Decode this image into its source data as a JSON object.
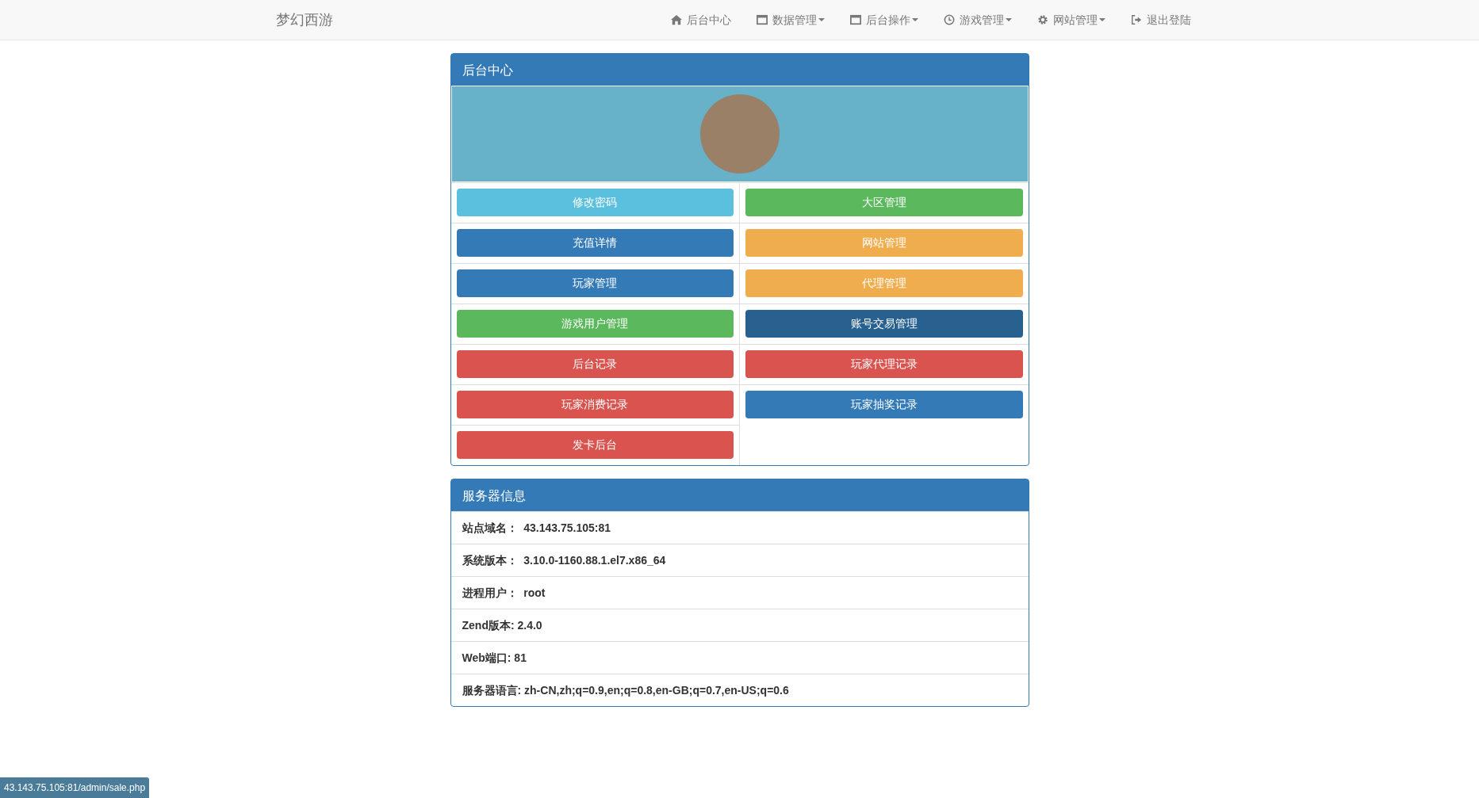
{
  "navbar": {
    "brand": "梦幻西游",
    "items": [
      {
        "label": "后台中心",
        "kind": "home",
        "dropdown": false
      },
      {
        "label": "数据管理",
        "kind": "window",
        "dropdown": true
      },
      {
        "label": "后台操作",
        "kind": "window",
        "dropdown": true
      },
      {
        "label": "游戏管理",
        "kind": "clock",
        "dropdown": true
      },
      {
        "label": "网站管理",
        "kind": "gear",
        "dropdown": true
      },
      {
        "label": "退出登陆",
        "kind": "logout",
        "dropdown": false
      }
    ]
  },
  "admin_panel": {
    "title": "后台中心",
    "buttons": [
      {
        "label": "修改密码",
        "color": "#5bc0de"
      },
      {
        "label": "大区管理",
        "color": "#5cb85c"
      },
      {
        "label": "充值详情",
        "color": "#337ab7"
      },
      {
        "label": "网站管理",
        "color": "#f0ad4e"
      },
      {
        "label": "玩家管理",
        "color": "#337ab7"
      },
      {
        "label": "代理管理",
        "color": "#f0ad4e"
      },
      {
        "label": "游戏用户管理",
        "color": "#5cb85c"
      },
      {
        "label": "账号交易管理",
        "color": "#286090"
      },
      {
        "label": "后台记录",
        "color": "#d9534f"
      },
      {
        "label": "玩家代理记录",
        "color": "#d9534f"
      },
      {
        "label": "玩家消费记录",
        "color": "#d9534f"
      },
      {
        "label": "玩家抽奖记录",
        "color": "#337ab7"
      },
      {
        "label": "发卡后台",
        "color": "#d9534f"
      }
    ]
  },
  "server_panel": {
    "title": "服务器信息",
    "rows": [
      "站点域名：  43.143.75.105:81",
      "系统版本：  3.10.0-1160.88.1.el7.x86_64",
      "进程用户：  root",
      "Zend版本: 2.4.0",
      "Web端口: 81",
      "服务器语言: zh-CN,zh;q=0.9,en;q=0.8,en-GB;q=0.7,en-US;q=0.6"
    ]
  },
  "status_bar": {
    "url": "43.143.75.105:81/admin/sale.php"
  }
}
